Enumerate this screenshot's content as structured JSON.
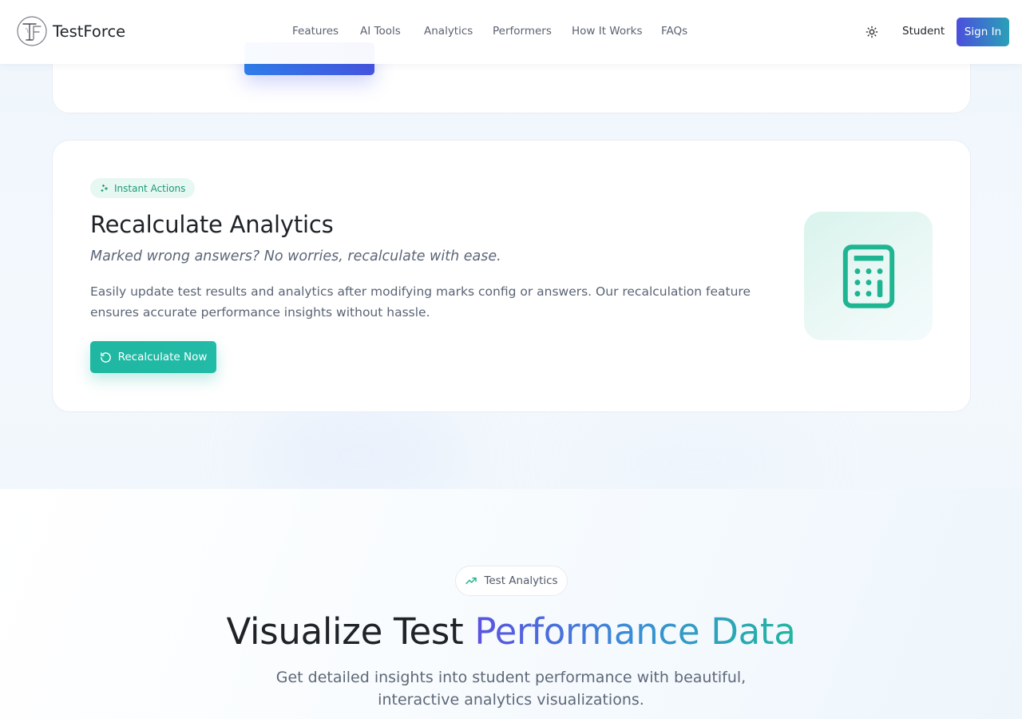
{
  "header": {
    "brand": "TestForce",
    "nav": [
      "Features",
      "AI Tools",
      "Analytics",
      "Performers",
      "How It Works",
      "FAQs"
    ],
    "student_label": "Student",
    "signin_label": "Sign In"
  },
  "recalc_card": {
    "badge": "Instant Actions",
    "title": "Recalculate Analytics",
    "subtitle": "Marked wrong answers? No worries, recalculate with ease.",
    "description": "Easily update test results and analytics after modifying marks config or answers. Our recalculation feature ensures accurate performance insights without hassle.",
    "button_label": "Recalculate Now"
  },
  "analytics_section": {
    "badge": "Test Analytics",
    "title_plain": "Visualize Test ",
    "title_highlight": "Performance Data",
    "description": "Get detailed insights into student performance with beautiful, interactive analytics visualizations."
  },
  "colors": {
    "accent_teal": "#1fb7a1",
    "accent_indigo": "#4b4fdc",
    "accent_blue": "#2f7dea"
  },
  "icons": {
    "theme_toggle": "sun-icon",
    "badge_instant": "sparkles-icon",
    "button_recalc": "refresh-icon",
    "tile": "calculator-icon",
    "badge_analytics": "trending-up-icon"
  }
}
